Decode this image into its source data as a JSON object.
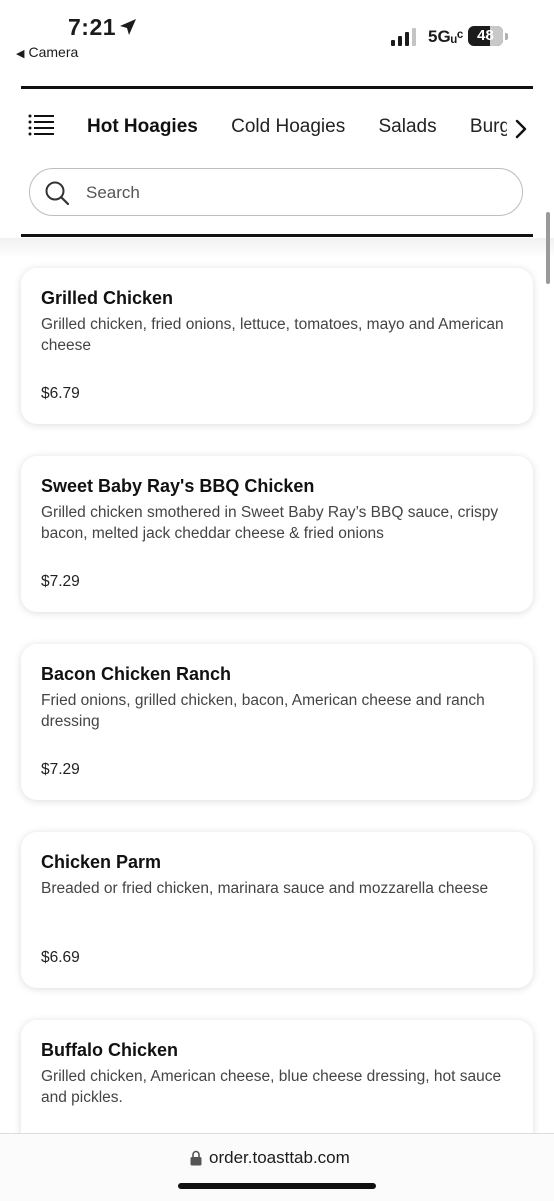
{
  "status_bar": {
    "time": "7:21",
    "back_label": "Camera",
    "network": "5Gᵤᶜ",
    "battery": "48"
  },
  "category_tabs": [
    {
      "label": "Hot Hoagies",
      "active": true
    },
    {
      "label": "Cold Hoagies",
      "active": false
    },
    {
      "label": "Salads",
      "active": false
    },
    {
      "label": "Burgers",
      "active": false
    }
  ],
  "search": {
    "placeholder": "Search"
  },
  "menu_items": [
    {
      "name": "Grilled Chicken",
      "description": "Grilled chicken, fried onions, lettuce, tomatoes, mayo and American cheese",
      "price": "$6.79"
    },
    {
      "name": "Sweet Baby Ray's BBQ Chicken",
      "description": "Grilled chicken smothered in Sweet Baby Ray’s BBQ sauce, crispy bacon, melted jack cheddar cheese & fried onions",
      "price": "$7.29"
    },
    {
      "name": "Bacon Chicken Ranch",
      "description": "Fried onions, grilled chicken, bacon, American cheese and ranch dressing",
      "price": "$7.29"
    },
    {
      "name": "Chicken Parm",
      "description": "Breaded or fried chicken, marinara sauce and mozzarella cheese",
      "price": "$6.69"
    },
    {
      "name": "Buffalo Chicken",
      "description": "Grilled chicken, American cheese, blue cheese dressing, hot sauce and pickles.",
      "price": ""
    }
  ],
  "browser": {
    "url": "order.toasttab.com"
  },
  "colors": {
    "text": "#1b1b1b",
    "rule": "#111111",
    "card_bg": "#ffffff"
  }
}
